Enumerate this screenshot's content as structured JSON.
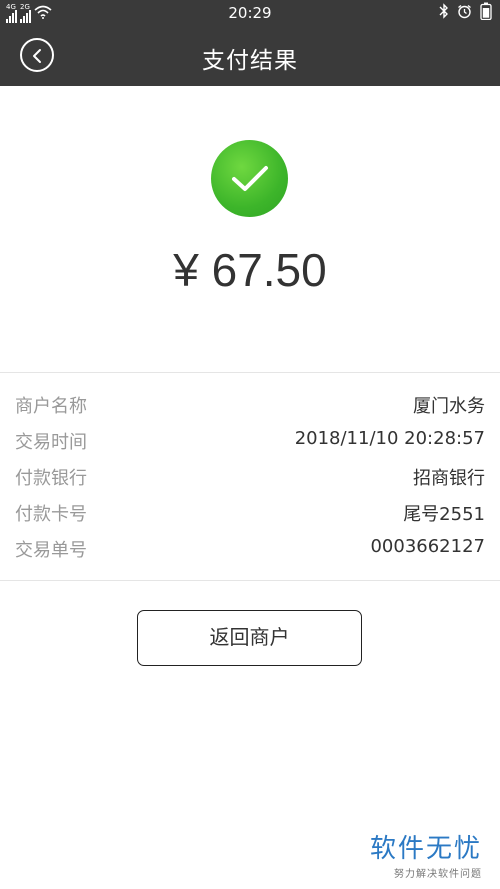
{
  "status_bar": {
    "time": "20:29",
    "signal_1_label": "4G",
    "signal_2_label": "2G",
    "icons": [
      "signal-icon",
      "signal-icon",
      "wifi-icon",
      "bluetooth-icon",
      "alarm-icon",
      "battery-icon"
    ]
  },
  "header": {
    "title": "支付结果",
    "back_icon": "back-chevron-icon"
  },
  "result": {
    "status_icon": "check-icon",
    "amount": "¥ 67.50",
    "accent_color": "#3db52a"
  },
  "details": [
    {
      "label": "商户名称",
      "value": "厦门水务"
    },
    {
      "label": "交易时间",
      "value": "2018/11/10 20:28:57"
    },
    {
      "label": "付款银行",
      "value": "招商银行"
    },
    {
      "label": "付款卡号",
      "value": "尾号2551"
    },
    {
      "label": "交易单号",
      "value": "0003662127"
    }
  ],
  "actions": {
    "return_label": "返回商户"
  },
  "watermark": {
    "brand": "软件无忧",
    "tagline": "努力解决软件问题"
  }
}
